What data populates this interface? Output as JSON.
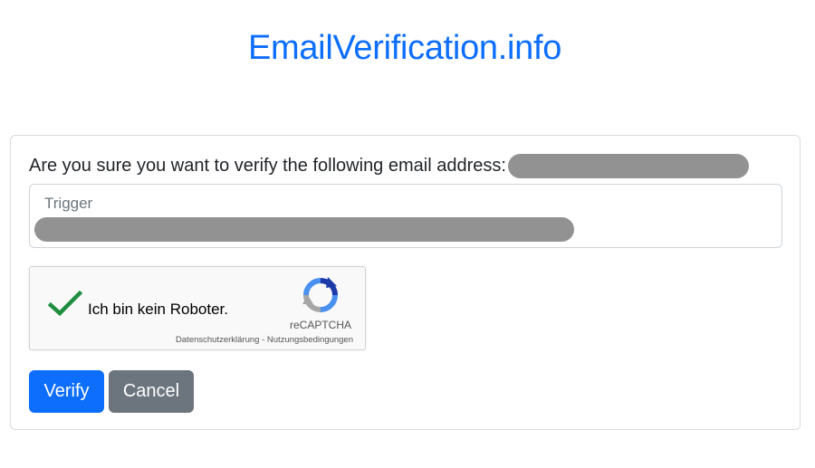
{
  "site": {
    "title": "EmailVerification.info"
  },
  "verify_card": {
    "question": "Are you sure you want to verify the following email address:",
    "trigger_label": "Trigger"
  },
  "recaptcha": {
    "label": "Ich bin kein Roboter.",
    "brand": "reCAPTCHA",
    "privacy_link": "Datenschutzerklärung",
    "separator": " - ",
    "terms_link": "Nutzungsbedingungen",
    "checked": true,
    "check_color": "#1e8e3e"
  },
  "actions": {
    "verify_label": "Verify",
    "cancel_label": "Cancel"
  },
  "colors": {
    "primary": "#0d6efd",
    "secondary": "#6c757d",
    "redaction": "#929292"
  }
}
